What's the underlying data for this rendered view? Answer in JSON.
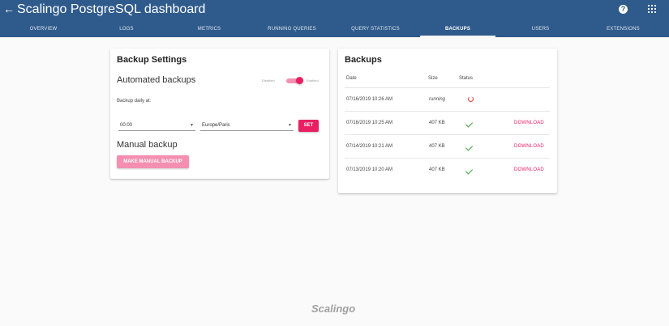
{
  "header": {
    "title": "Scalingo PostgreSQL dashboard",
    "icons": {
      "back": "arrow-left-icon",
      "help": "help-icon",
      "apps": "apps-grid-icon"
    }
  },
  "tabs": [
    {
      "label": "OVERVIEW",
      "active": false
    },
    {
      "label": "LOGS",
      "active": false
    },
    {
      "label": "METRICS",
      "active": false
    },
    {
      "label": "RUNNING QUERIES",
      "active": false
    },
    {
      "label": "QUERY STATISTICS",
      "active": false
    },
    {
      "label": "BACKUPS",
      "active": true
    },
    {
      "label": "USERS",
      "active": false
    },
    {
      "label": "EXTENSIONS",
      "active": false
    }
  ],
  "settings": {
    "title": "Backup Settings",
    "automated_title": "Automated backups",
    "toggle": {
      "off_label": "Disabled",
      "on_label": "Enabled",
      "checked": true
    },
    "daily_label": "Backup daily at:",
    "time_value": "00:00",
    "timezone_value": "Europe/Paris",
    "set_label": "SET",
    "manual_title": "Manual backup",
    "manual_button": "MAKE MANUAL BACKUP"
  },
  "backups": {
    "title": "Backups",
    "columns": {
      "date": "Date",
      "size": "Size",
      "status": "Status"
    },
    "rows": [
      {
        "date": "07/16/2019 10:26 AM",
        "size": "running",
        "status": "running",
        "action": ""
      },
      {
        "date": "07/16/2019 10:25 AM",
        "size": "407 KB",
        "status": "done",
        "action": "DOWNLOAD"
      },
      {
        "date": "07/14/2019 10:21 AM",
        "size": "407 KB",
        "status": "done",
        "action": "DOWNLOAD"
      },
      {
        "date": "07/13/2019 10:20 AM",
        "size": "407 KB",
        "status": "done",
        "action": "DOWNLOAD"
      }
    ]
  },
  "footer": {
    "logo_text": "Scalingo"
  },
  "colors": {
    "header": "#2f5b8c",
    "accent": "#e91e63",
    "success": "#43a047",
    "running": "#e53935"
  }
}
